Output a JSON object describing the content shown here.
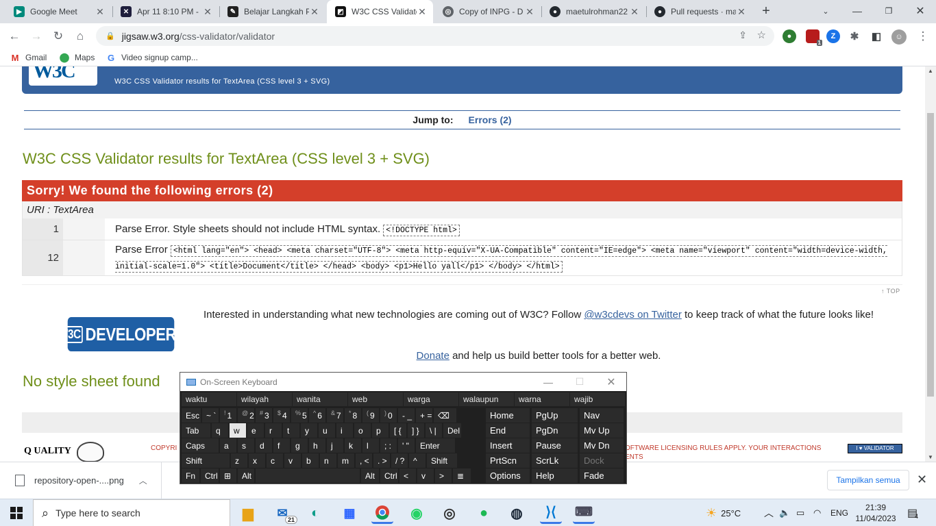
{
  "browser": {
    "tabs": [
      {
        "title": "Google Meet",
        "icon": "google-meet-icon",
        "active": false
      },
      {
        "title": "Apr 11 8:10 PM - ",
        "icon": "zoom-icon",
        "active": false
      },
      {
        "title": "Belajar Langkah P",
        "icon": "notion-icon",
        "active": false
      },
      {
        "title": "W3C CSS Validato",
        "icon": "w3c-icon",
        "active": true
      },
      {
        "title": "Copy of INPG - D",
        "icon": "globe-icon",
        "active": false
      },
      {
        "title": "maetulrohman22",
        "icon": "github-icon",
        "active": false
      },
      {
        "title": "Pull requests · ma",
        "icon": "github-icon",
        "active": false
      }
    ],
    "url_domain": "jigsaw.w3.org",
    "url_path": "/css-validator/validator",
    "bookmarks": [
      {
        "label": "Gmail",
        "icon": "gmail-icon"
      },
      {
        "label": "Maps",
        "icon": "maps-icon"
      },
      {
        "label": "Video signup camp...",
        "icon": "google-icon"
      }
    ],
    "extension_badge": "1"
  },
  "page": {
    "banner_subtitle": "W3C CSS Validator results for TextArea (CSS level 3 + SVG)",
    "jump_label": "Jump to:",
    "jump_link": "Errors (2)",
    "title": "W3C CSS Validator results for TextArea (CSS level 3 + SVG)",
    "errors_heading": "Sorry! We found the following errors (2)",
    "uri_label": "URI : TextArea",
    "errors": [
      {
        "line": "1",
        "message": "Parse Error. Style sheets should not include HTML syntax.",
        "code": "<!DOCTYPE html>"
      },
      {
        "line": "12",
        "message": "Parse Error",
        "code": "<html lang=\"en\"> <head> <meta charset=\"UTF-8\"> <meta http-equiv=\"X-UA-Compatible\" content=\"IE=edge\"> <meta name=\"viewport\" content=\"width=device-width, initial-scale=1.0\"> <title>Document</title> </head> <body> <p1>Hello yall</p1> </body> </html>"
      }
    ],
    "top_link": "↑ TOP",
    "devlogo_w3c": "W3C",
    "devlogo_text": "DEVELOPERS",
    "interest_pre": "Interested in understanding what new technologies are coming out of W3C? Follow ",
    "interest_link": "@w3cdevs on Twitter",
    "interest_post": " to keep track of what the future looks like!",
    "donate_link": "Donate",
    "donate_post": " and help us build better tools for a better web.",
    "no_stylesheet": "No style sheet found",
    "footer_copy": "COPYRI",
    "footer_lic1": "OFTWARE LICENSING RULES APPLY. YOUR INTERACTIONS",
    "footer_lic2": "ENTS",
    "footer_badge": "I ♥ VALIDATOR",
    "footer_quality": "Q UALITY"
  },
  "downloads": {
    "file": "repository-open-....png",
    "show_all": "Tampilkan semua"
  },
  "osk": {
    "title": "On-Screen Keyboard",
    "predictions": [
      "waktu",
      "wilayah",
      "wanita",
      "web",
      "warga",
      "walaupun",
      "warna",
      "wajib"
    ],
    "rows": [
      [
        [
          "Esc",
          ""
        ],
        [
          "~ `",
          ""
        ],
        [
          "1",
          "!"
        ],
        [
          "2",
          "@"
        ],
        [
          "3",
          "#"
        ],
        [
          "4",
          "$"
        ],
        [
          "5",
          "%"
        ],
        [
          "6",
          "^"
        ],
        [
          "7",
          "&"
        ],
        [
          "8",
          "*"
        ],
        [
          "9",
          "("
        ],
        [
          "0",
          ")"
        ],
        [
          "- _",
          ""
        ],
        [
          "+ =",
          ""
        ],
        [
          "⌫",
          ""
        ]
      ],
      [
        [
          "Tab",
          ""
        ],
        [
          "q",
          ""
        ],
        [
          "w",
          ""
        ],
        [
          "e",
          ""
        ],
        [
          "r",
          ""
        ],
        [
          "t",
          ""
        ],
        [
          "y",
          ""
        ],
        [
          "u",
          ""
        ],
        [
          "i",
          ""
        ],
        [
          "o",
          ""
        ],
        [
          "p",
          ""
        ],
        [
          "[ {",
          ""
        ],
        [
          "] }",
          ""
        ],
        [
          "\\ |",
          ""
        ],
        [
          "Del",
          ""
        ]
      ],
      [
        [
          "Caps",
          ""
        ],
        [
          "a",
          ""
        ],
        [
          "s",
          ""
        ],
        [
          "d",
          ""
        ],
        [
          "f",
          ""
        ],
        [
          "g",
          ""
        ],
        [
          "h",
          ""
        ],
        [
          "j",
          ""
        ],
        [
          "k",
          ""
        ],
        [
          "l",
          ""
        ],
        [
          "; :",
          ""
        ],
        [
          "' \"",
          ""
        ],
        [
          "Enter",
          ""
        ]
      ],
      [
        [
          "Shift",
          ""
        ],
        [
          "z",
          ""
        ],
        [
          "x",
          ""
        ],
        [
          "c",
          ""
        ],
        [
          "v",
          ""
        ],
        [
          "b",
          ""
        ],
        [
          "n",
          ""
        ],
        [
          "m",
          ""
        ],
        [
          ", <",
          ""
        ],
        [
          ". >",
          ""
        ],
        [
          "/ ?",
          ""
        ],
        [
          "^",
          ""
        ],
        [
          "Shift",
          ""
        ]
      ],
      [
        [
          "Fn",
          ""
        ],
        [
          "Ctrl",
          ""
        ],
        [
          "⊞",
          ""
        ],
        [
          "Alt",
          ""
        ],
        [
          "",
          ""
        ],
        [
          "Alt",
          ""
        ],
        [
          "Ctrl",
          ""
        ],
        [
          "<",
          ""
        ],
        [
          "v",
          ""
        ],
        [
          ">",
          ""
        ],
        [
          "≣",
          ""
        ]
      ]
    ],
    "nav_keys": [
      [
        "Home",
        "PgUp",
        "Nav"
      ],
      [
        "End",
        "PgDn",
        "Mv Up"
      ],
      [
        "Insert",
        "Pause",
        "Mv Dn"
      ],
      [
        "PrtScn",
        "ScrLk",
        "Dock"
      ],
      [
        "Options",
        "Help",
        "Fade"
      ]
    ]
  },
  "taskbar": {
    "search_placeholder": "Type here to search",
    "mail_badge": "21",
    "temperature": "25°C",
    "language": "ENG",
    "time": "21:39",
    "date": "11/04/2023",
    "notif_count": "4"
  },
  "colors": {
    "w3c_blue": "#36629e",
    "error_red": "#d43f2a",
    "title_green": "#6f8f1a"
  }
}
